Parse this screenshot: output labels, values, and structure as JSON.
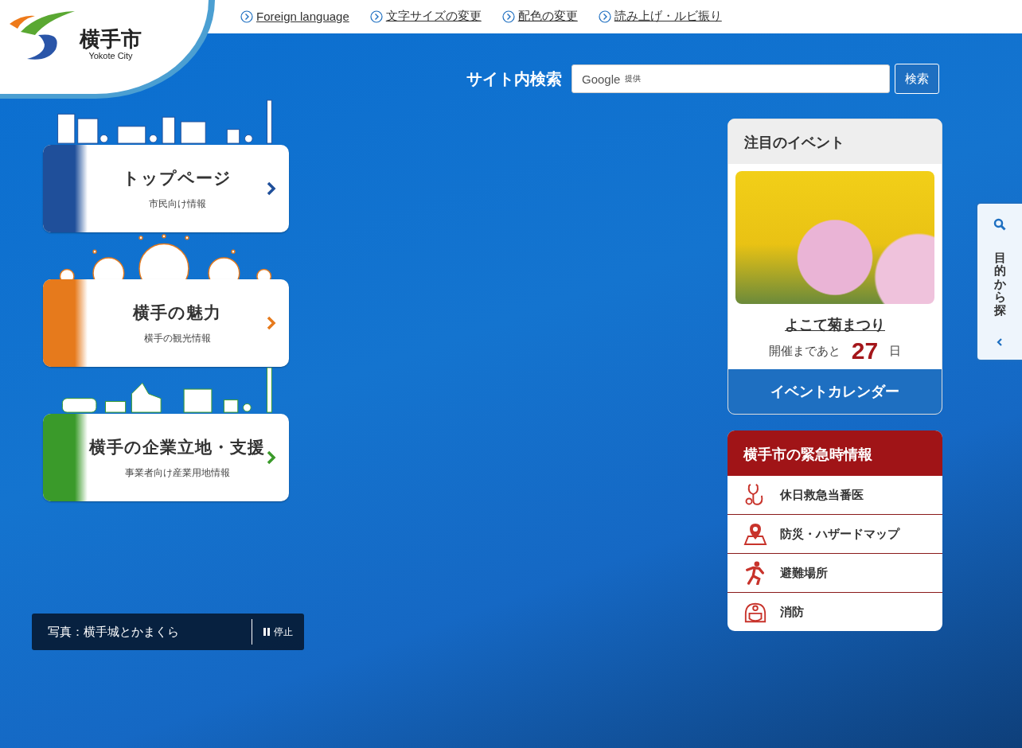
{
  "header": {
    "logo_text": "横手市",
    "logo_subtext": "Yokote City",
    "links": [
      "Foreign language",
      "文字サイズの変更",
      "配色の変更",
      "読み上げ・ルビ振り"
    ]
  },
  "search": {
    "label": "サイト内検索",
    "brand": "Google",
    "brand_note": "提供",
    "button": "検索"
  },
  "portal_cards": [
    {
      "title": "トップページ",
      "subtitle": "市民向け情報",
      "color": "#1f4f9a",
      "kind": "city"
    },
    {
      "title": "横手の魅力",
      "subtitle": "横手の観光情報",
      "color": "#e67a1c",
      "kind": "kamakura"
    },
    {
      "title": "横手の企業立地・支援",
      "subtitle": "事業者向け産業用地情報",
      "color": "#3a9a2a",
      "kind": "industry"
    }
  ],
  "photo_caption": {
    "text": "写真：横手城とかまくら",
    "button": "停止"
  },
  "event": {
    "heading": "注目のイベント",
    "title": "よこて菊まつり",
    "countdown_prefix": "開催まであと",
    "days": "27",
    "countdown_suffix": "日",
    "button": "イベントカレンダー"
  },
  "emergency": {
    "heading": "横手市の緊急時情報",
    "items": [
      {
        "label": "休日救急当番医",
        "kind": "doctor"
      },
      {
        "label": "防災・ハザードマップ",
        "kind": "map"
      },
      {
        "label": "避難場所",
        "kind": "evacuation"
      },
      {
        "label": "消防",
        "kind": "fire"
      }
    ]
  },
  "side_tab": {
    "label": "目的から探"
  }
}
